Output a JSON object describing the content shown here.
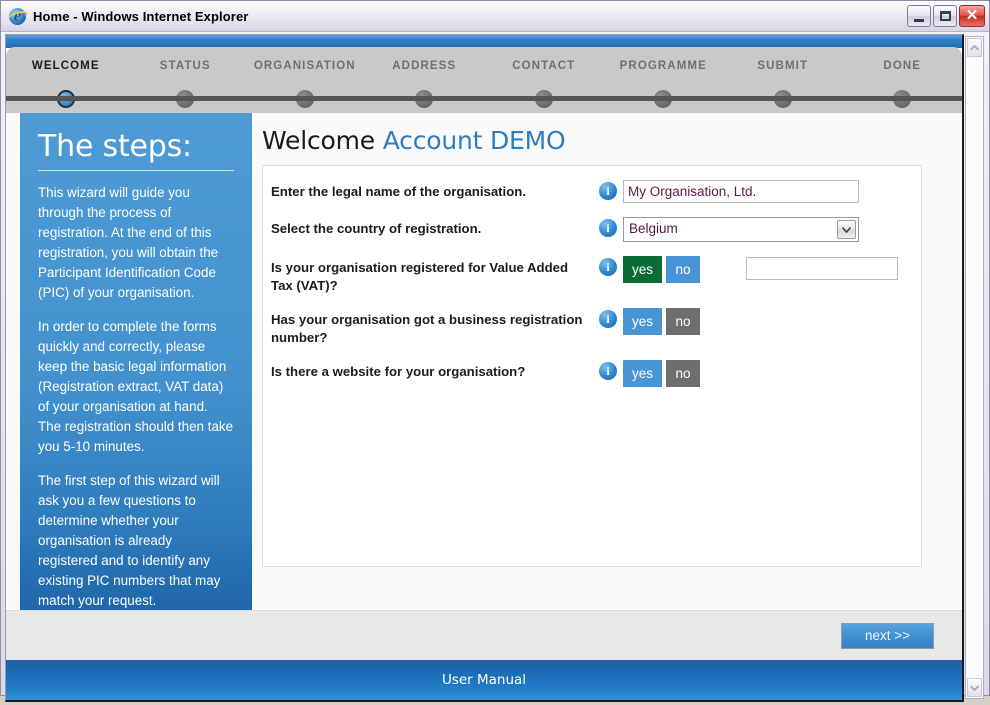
{
  "window": {
    "title": "Home - Windows Internet Explorer",
    "icon": "internet-explorer-icon",
    "minimize_label": "",
    "maximize_label": "",
    "close_label": "✕"
  },
  "steps": [
    {
      "label": "WELCOME",
      "active": true
    },
    {
      "label": "STATUS",
      "active": false
    },
    {
      "label": "ORGANISATION",
      "active": false
    },
    {
      "label": "ADDRESS",
      "active": false
    },
    {
      "label": "CONTACT",
      "active": false
    },
    {
      "label": "PROGRAMME",
      "active": false
    },
    {
      "label": "SUBMIT",
      "active": false
    },
    {
      "label": "DONE",
      "active": false
    }
  ],
  "sidebar": {
    "heading": "The steps:",
    "paragraphs": [
      "This wizard will guide you through the process of registration. At the end of this registration, you will obtain the Participant Identification Code (PIC) of your organisation.",
      "In order to complete the forms quickly and correctly, please keep the basic legal information (Registration extract, VAT data) of your organisation at hand. The registration should then take you 5-10 minutes.",
      "The first step of this wizard will ask you a few questions to determine whether your organisation is already registered and to identify any existing PIC numbers that may match your request."
    ]
  },
  "page": {
    "title_main": "Welcome",
    "title_accent": "Account DEMO"
  },
  "form": {
    "rows": [
      {
        "question": "Enter the legal name of the organisation.",
        "info_icon": "info-icon",
        "control": "text",
        "value": "My Organisation, Ltd.",
        "placeholder": ""
      },
      {
        "question": "Select the country of registration.",
        "info_icon": "info-icon",
        "control": "select",
        "value": "Belgium",
        "options": [
          "Belgium"
        ]
      },
      {
        "question": "Is your organisation registered for Value Added Tax (VAT)?",
        "info_icon": "info-icon",
        "control": "yesno-with-text",
        "yes_label": "yes",
        "no_label": "no",
        "selected": "yes",
        "text_value": "",
        "text_placeholder": ""
      },
      {
        "question": "Has your organisation got a business registration number?",
        "info_icon": "info-icon",
        "control": "yesno",
        "yes_label": "yes",
        "no_label": "no",
        "selected": ""
      },
      {
        "question": "Is there a website for your organisation?",
        "info_icon": "info-icon",
        "control": "yesno",
        "yes_label": "yes",
        "no_label": "no",
        "selected": ""
      }
    ]
  },
  "footer": {
    "next_label": "next >>"
  },
  "manual_bar": {
    "label": "User Manual"
  },
  "colors": {
    "accent_blue": "#2e7dbd",
    "sidebar_blue": "#4291ce",
    "selected_green": "#0a6b35",
    "button_blue": "#4795d4",
    "disabled_grey": "#6e6e6e",
    "step_rail": "#555555",
    "manual_bar": "#1f78c2"
  }
}
